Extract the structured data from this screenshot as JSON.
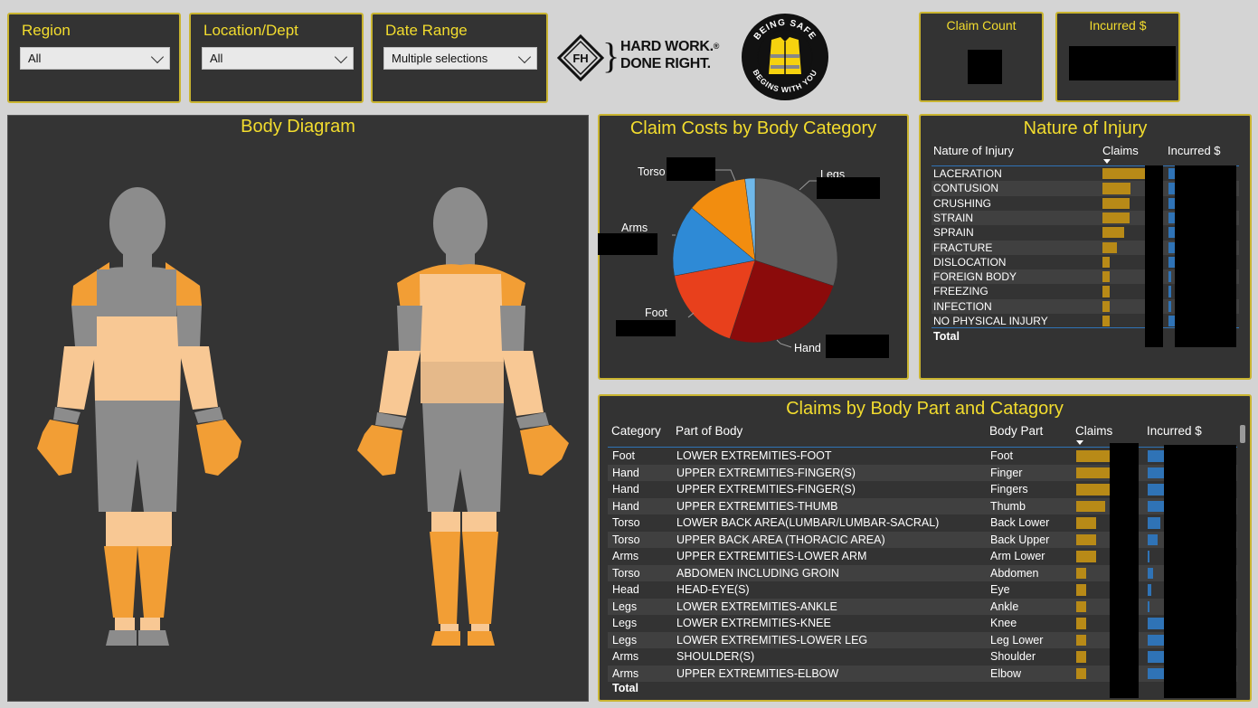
{
  "filters": {
    "region": {
      "label": "Region",
      "value": "All"
    },
    "location": {
      "label": "Location/Dept",
      "value": "All"
    },
    "date_range": {
      "label": "Date Range",
      "value": "Multiple selections"
    }
  },
  "brand": {
    "tagline_line1": "HARD WORK.",
    "tagline_line2": "DONE RIGHT.",
    "trademark": "®",
    "monogram": "FH",
    "badge_top": "BEING SAFE",
    "badge_bottom": "BEGINS WITH YOU"
  },
  "kpis": {
    "claim_count_label": "Claim Count",
    "incurred_label": "Incurred $"
  },
  "body_diagram": {
    "title": "Body Diagram"
  },
  "pie": {
    "title": "Claim Costs by Body Category",
    "chart_data": {
      "type": "pie",
      "title": "Claim Costs by Body Category",
      "slices": [
        {
          "name": "Legs",
          "value": 30,
          "color": "#5f5f5f"
        },
        {
          "name": "Hand",
          "value": 25,
          "color": "#8b0b0b"
        },
        {
          "name": "Foot",
          "value": 17,
          "color": "#e8401c"
        },
        {
          "name": "Arms",
          "value": 14,
          "color": "#2e8ad6"
        },
        {
          "name": "Torso",
          "value": 12,
          "color": "#f28d0f"
        },
        {
          "name": "",
          "value": 2,
          "color": "#6fb8ea"
        }
      ]
    },
    "labels": {
      "legs": "Legs",
      "hand": "Hand",
      "foot": "Foot",
      "arms": "Arms",
      "torso": "Torso"
    }
  },
  "nature": {
    "title": "Nature of Injury",
    "col1": "Nature of Injury",
    "col2": "Claims",
    "col3": "Incurred $",
    "rows": [
      {
        "name": "LACERATION",
        "claims": 100,
        "inc": 14
      },
      {
        "name": "CONTUSION",
        "claims": 65,
        "inc": 14
      },
      {
        "name": "CRUSHING",
        "claims": 62,
        "inc": 14
      },
      {
        "name": "STRAIN",
        "claims": 62,
        "inc": 14
      },
      {
        "name": "SPRAIN",
        "claims": 50,
        "inc": 14
      },
      {
        "name": "FRACTURE",
        "claims": 34,
        "inc": 14
      },
      {
        "name": "DISLOCATION",
        "claims": 16,
        "inc": 14
      },
      {
        "name": "FOREIGN BODY",
        "claims": 16,
        "inc": 5
      },
      {
        "name": "FREEZING",
        "claims": 16,
        "inc": 5
      },
      {
        "name": "INFECTION",
        "claims": 16,
        "inc": 5
      },
      {
        "name": "NO PHYSICAL INJURY",
        "claims": 16,
        "inc": 14
      }
    ],
    "total": "Total"
  },
  "claims_table": {
    "title": "Claims by Body Part and Catagory",
    "col_category": "Category",
    "col_part": "Part of Body",
    "col_bodypart": "Body Part",
    "col_claims": "Claims",
    "col_incurred": "Incurred $",
    "rows": [
      {
        "cat": "Foot",
        "part": "LOWER EXTREMITIES-FOOT",
        "bp": "Foot",
        "claims": 100,
        "inc": 50
      },
      {
        "cat": "Hand",
        "part": "UPPER EXTREMITIES-FINGER(S)",
        "bp": "Finger",
        "claims": 100,
        "inc": 50
      },
      {
        "cat": "Hand",
        "part": "UPPER EXTREMITIES-FINGER(S)",
        "bp": "Fingers",
        "claims": 100,
        "inc": 50
      },
      {
        "cat": "Hand",
        "part": "UPPER EXTREMITIES-THUMB",
        "bp": "Thumb",
        "claims": 85,
        "inc": 50
      },
      {
        "cat": "Torso",
        "part": "LOWER BACK AREA(LUMBAR/LUMBAR-SACRAL)",
        "bp": "Back Lower",
        "claims": 58,
        "inc": 40
      },
      {
        "cat": "Torso",
        "part": "UPPER BACK AREA (THORACIC AREA)",
        "bp": "Back Upper",
        "claims": 58,
        "inc": 30
      },
      {
        "cat": "Arms",
        "part": "UPPER EXTREMITIES-LOWER ARM",
        "bp": "Arm Lower",
        "claims": 58,
        "inc": 5
      },
      {
        "cat": "Torso",
        "part": "ABDOMEN INCLUDING GROIN",
        "bp": "Abdomen",
        "claims": 28,
        "inc": 18
      },
      {
        "cat": "Head",
        "part": "HEAD-EYE(S)",
        "bp": "Eye",
        "claims": 28,
        "inc": 12
      },
      {
        "cat": "Legs",
        "part": "LOWER EXTREMITIES-ANKLE",
        "bp": "Ankle",
        "claims": 28,
        "inc": 5
      },
      {
        "cat": "Legs",
        "part": "LOWER EXTREMITIES-KNEE",
        "bp": "Knee",
        "claims": 28,
        "inc": 50
      },
      {
        "cat": "Legs",
        "part": "LOWER EXTREMITIES-LOWER LEG",
        "bp": "Leg Lower",
        "claims": 28,
        "inc": 50
      },
      {
        "cat": "Arms",
        "part": "SHOULDER(S)",
        "bp": "Shoulder",
        "claims": 28,
        "inc": 50
      },
      {
        "cat": "Arms",
        "part": "UPPER EXTREMITIES-ELBOW",
        "bp": "Elbow",
        "claims": 28,
        "inc": 50
      }
    ],
    "total": "Total"
  },
  "colors": {
    "accent": "#f2dc2e",
    "border": "#c9b430",
    "panel": "#333333",
    "bar_claims": "#b88a17",
    "bar_incurred": "#2f73b6",
    "highlight_light": "#f8c894",
    "highlight_dark": "#f29e35",
    "body_grey": "#8c8c8c"
  }
}
